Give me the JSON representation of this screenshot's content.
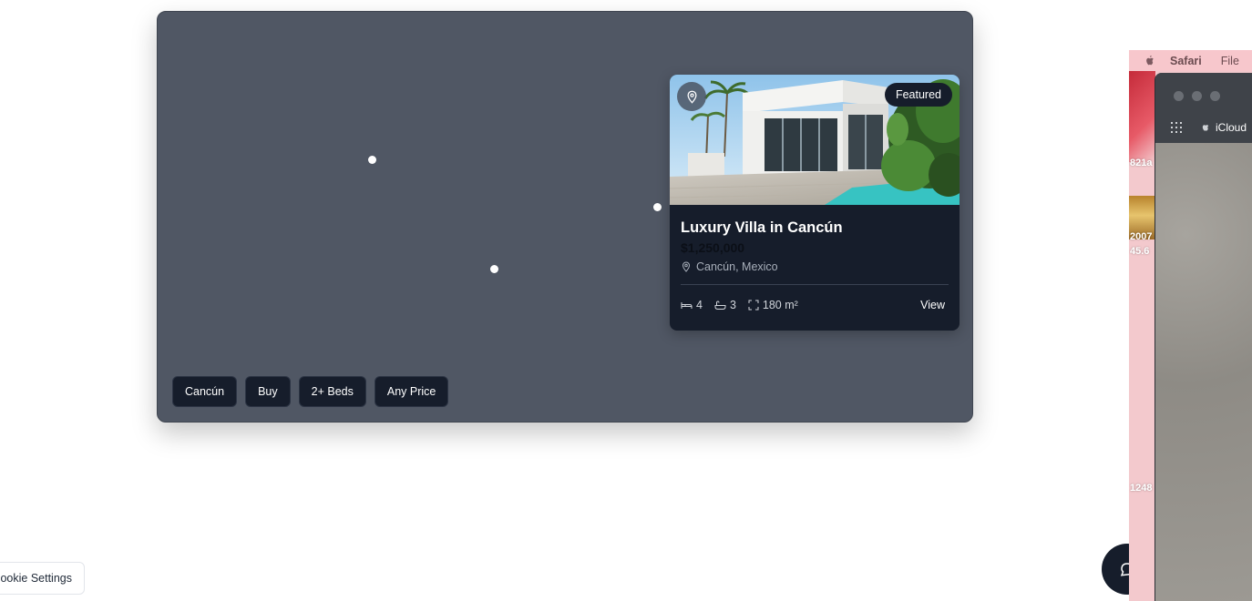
{
  "listing_card": {
    "badge": "Featured",
    "title": "Luxury Villa in Cancún",
    "price": "$1,250,000",
    "location": "Cancún, Mexico",
    "beds": "4",
    "baths": "3",
    "area": "180 m²",
    "view_label": "View"
  },
  "filters": [
    {
      "label": "Cancún"
    },
    {
      "label": "Buy"
    },
    {
      "label": "2+ Beds"
    },
    {
      "label": "Any Price"
    }
  ],
  "cookie_settings_label": "Cookie Settings",
  "cookie_settings_visible_text": "ookie Settings",
  "background_screenshot": {
    "menubar": {
      "app": "Safari",
      "menu": "File"
    },
    "tab_label": "iCloud",
    "side_text": [
      "821a",
      "2007",
      "45.6",
      "1248"
    ]
  },
  "colors": {
    "map_panel": "#505764",
    "card_bg": "#161d2b",
    "chip_bg": "#161d2b"
  }
}
